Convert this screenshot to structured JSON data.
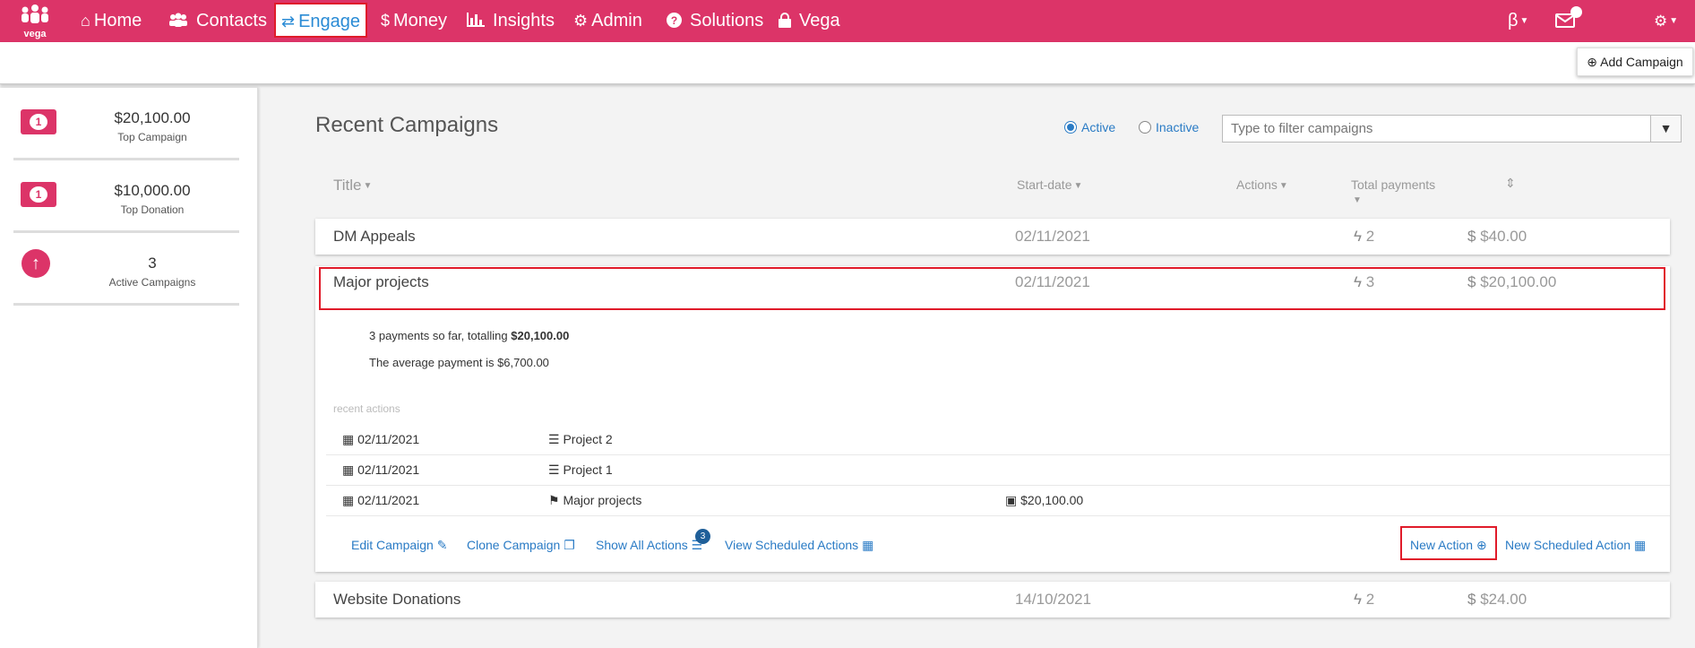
{
  "brand": {
    "logo_text": "vega"
  },
  "nav": {
    "items": [
      {
        "label": "Home",
        "icon": "home-icon"
      },
      {
        "label": "Contacts",
        "icon": "users-icon"
      },
      {
        "label": "Engage",
        "icon": "exchange-icon"
      },
      {
        "label": "Money",
        "icon": "dollar-icon"
      },
      {
        "label": "Insights",
        "icon": "bar-chart-icon"
      },
      {
        "label": "Admin",
        "icon": "cogs-icon"
      },
      {
        "label": "Solutions",
        "icon": "question-circle-icon"
      },
      {
        "label": "Vega",
        "icon": "lock-icon"
      }
    ],
    "beta_symbol": "β"
  },
  "toolbar": {
    "add_campaign_label": "Add Campaign"
  },
  "sidebar": {
    "stats": [
      {
        "value": "$20,100.00",
        "label": "Top Campaign",
        "icon": "money-icon"
      },
      {
        "value": "$10,000.00",
        "label": "Top Donation",
        "icon": "money-icon"
      },
      {
        "value": "3",
        "label": "Active Campaigns",
        "icon": "arrow-circle-up-icon"
      }
    ]
  },
  "main": {
    "title": "Recent Campaigns",
    "filter": {
      "active_label": "Active",
      "inactive_label": "Inactive",
      "selected": "Active",
      "search_placeholder": "Type to filter campaigns"
    },
    "columns": {
      "title": "Title",
      "start_date": "Start-date",
      "actions": "Actions",
      "total_payments": "Total payments"
    },
    "campaigns": [
      {
        "title": "DM Appeals",
        "start_date": "02/11/2021",
        "actions": "2",
        "total": "$40.00"
      },
      {
        "title": "Major projects",
        "start_date": "02/11/2021",
        "actions": "3",
        "total": "$20,100.00"
      },
      {
        "title": "Website Donations",
        "start_date": "14/10/2021",
        "actions": "2",
        "total": "$24.00"
      }
    ],
    "expanded": {
      "summary_prefix": "3 payments so far, totalling ",
      "summary_total": "$20,100.00",
      "average_text": "The average payment is $6,700.00",
      "recent_label": "recent actions",
      "recent_actions": [
        {
          "date": "02/11/2021",
          "name": "Project 2",
          "type_icon": "list-icon",
          "amount": ""
        },
        {
          "date": "02/11/2021",
          "name": "Project 1",
          "type_icon": "list-icon",
          "amount": ""
        },
        {
          "date": "02/11/2021",
          "name": "Major projects",
          "type_icon": "flag-icon",
          "amount": "$20,100.00"
        }
      ],
      "links": {
        "edit": "Edit Campaign",
        "clone": "Clone Campaign",
        "show_all": "Show All Actions",
        "show_all_badge": "3",
        "view_scheduled": "View Scheduled Actions",
        "new_action": "New Action",
        "new_scheduled": "New Scheduled Action"
      }
    }
  },
  "colors": {
    "brand": "#dc3468",
    "link": "#2a7bc5",
    "highlight": "#e01b2a"
  }
}
